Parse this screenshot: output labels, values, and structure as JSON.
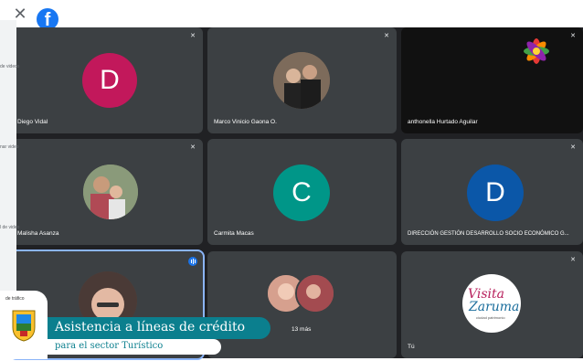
{
  "window": {
    "close_icon": "close-icon",
    "brand_icon": "facebook-icon",
    "brand_letter": "f"
  },
  "sidebar": {
    "lines": [
      "de videos",
      "l de videos",
      "nar video",
      "l de video",
      "l de tráfico"
    ]
  },
  "participants": [
    {
      "name": "Diego Vidal",
      "initial": "D",
      "color": "#c2185b"
    },
    {
      "name": "Marco Vinicio Gaona O.",
      "photo": true
    },
    {
      "name": "anthonella Hurtado Aguilar",
      "logo": true
    },
    {
      "name": "Malisha Asanza",
      "photo": true
    },
    {
      "name": "Carmita Macas",
      "initial": "C",
      "color": "#009688"
    },
    {
      "name": "DIRECCIÓN GESTIÓN DESARROLLO SOCIO ECONÓMICO G...",
      "initial": "D",
      "color": "#0b57a8"
    },
    {
      "name": "",
      "photo": true,
      "speaking": true
    },
    {
      "name": "13 más",
      "group": true
    },
    {
      "name": "Tú"
    }
  ],
  "banner": {
    "title": "Asistencia a líneas de crédito",
    "subtitle": "para el sector Turístico",
    "crest_text": "de tráfico",
    "accent": "#0b7f8e"
  },
  "visita_logo": {
    "line1": "Visita",
    "line2": "Zaruma",
    "line3": "ciudad patrimonio"
  }
}
